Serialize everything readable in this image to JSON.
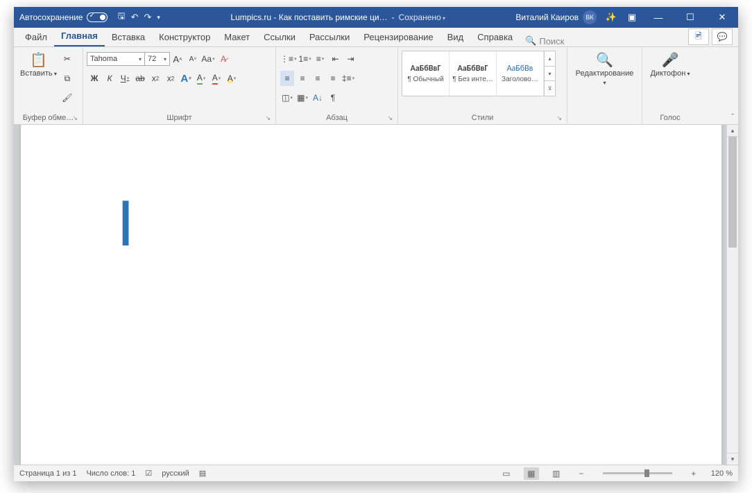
{
  "titlebar": {
    "autosave": "Автосохранение",
    "doc_title": "Lumpics.ru - Как поставить римские ци…",
    "saved": "Сохранено",
    "user_name": "Виталий Каиров",
    "user_initials": "ВК"
  },
  "tabs": {
    "file": "Файл",
    "home": "Главная",
    "insert": "Вставка",
    "design": "Конструктор",
    "layout": "Макет",
    "references": "Ссылки",
    "mailings": "Рассылки",
    "review": "Рецензирование",
    "view": "Вид",
    "help": "Справка",
    "search": "Поиск"
  },
  "ribbon": {
    "clipboard": {
      "label": "Буфер обме…",
      "paste": "Вставить"
    },
    "font": {
      "label": "Шрифт",
      "name": "Tahoma",
      "size": "72",
      "bold": "Ж",
      "italic": "К",
      "underline": "Ч",
      "strike": "ab",
      "sub": "x₂",
      "sup": "x²",
      "grow": "A˄",
      "shrink": "A˅",
      "case": "Aa",
      "clear": "A⊘",
      "effects": "A",
      "color": "A",
      "highlight": "A"
    },
    "paragraph": {
      "label": "Абзац"
    },
    "styles": {
      "label": "Стили",
      "preview": "АаБбВвГ",
      "preview_h": "АаБбВв",
      "items": [
        "¶ Обычный",
        "¶ Без инте…",
        "Заголово…"
      ]
    },
    "editing": {
      "label": "Редактирование"
    },
    "voice": {
      "label": "Голос",
      "dictate": "Диктофон"
    }
  },
  "document": {
    "text": "I"
  },
  "statusbar": {
    "page": "Страница 1 из 1",
    "words": "Число слов: 1",
    "lang": "русский",
    "zoom": "120 %"
  }
}
